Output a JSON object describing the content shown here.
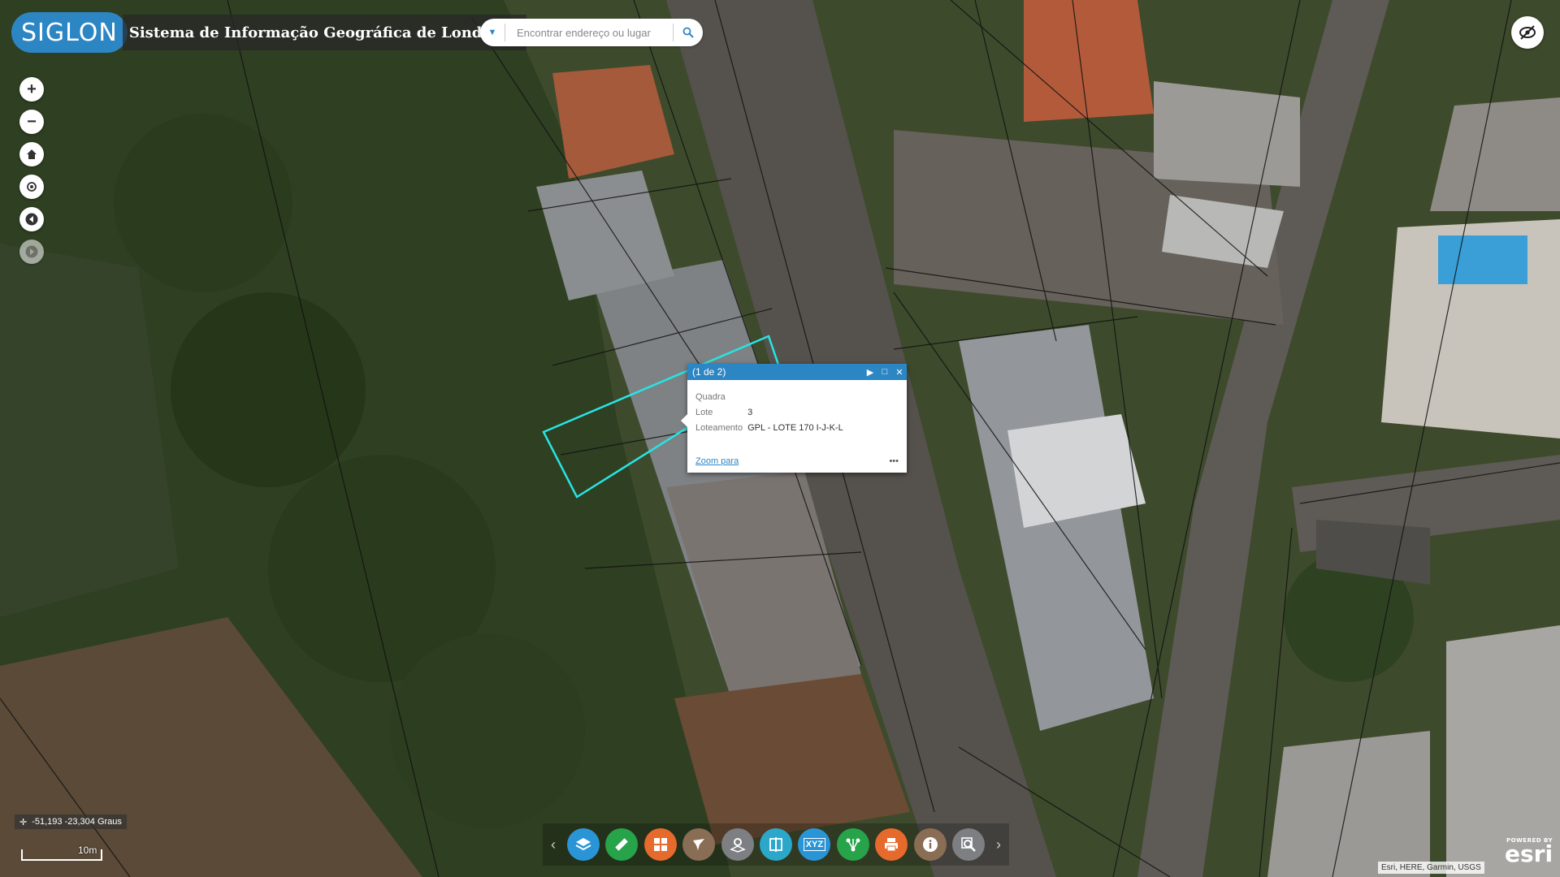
{
  "header": {
    "logo_text": "SIGLON",
    "title": "Sistema de Informação Geográfica de Londrina"
  },
  "search": {
    "placeholder": "Encontrar endereço ou lugar"
  },
  "popup": {
    "counter": "(1 de 2)",
    "fields": [
      {
        "label": "Quadra",
        "value": ""
      },
      {
        "label": "Lote",
        "value": "3"
      },
      {
        "label": "Loteamento",
        "value": "GPL - LOTE 170 I-J-K-L"
      }
    ],
    "zoom_link": "Zoom para",
    "more": "•••"
  },
  "coordinates": "-51,193 -23,304 Graus",
  "scale_label": "10m",
  "attribution": "Esri, HERE, Garmin, USGS",
  "esri_logo": {
    "powered_by": "POWERED BY",
    "brand": "esri"
  },
  "toolbar": {
    "tools": [
      {
        "name": "layers-tool",
        "icon": "layers-icon",
        "color": "#2a95d6"
      },
      {
        "name": "measure-tool",
        "icon": "ruler-icon",
        "color": "#27a34a"
      },
      {
        "name": "basemap-tool",
        "icon": "grid-icon",
        "color": "#e66a2c"
      },
      {
        "name": "draw-tool",
        "icon": "draw-icon",
        "color": "#8a6d55"
      },
      {
        "name": "bookmark-tool",
        "icon": "bookmark-icon",
        "color": "#7e7f83"
      },
      {
        "name": "swipe-tool",
        "icon": "swipe-icon",
        "color": "#2aa7c9"
      },
      {
        "name": "coordinate-tool",
        "icon": "xyz-icon",
        "color": "#2a95d6"
      },
      {
        "name": "share-tool",
        "icon": "share-icon",
        "color": "#27a34a"
      },
      {
        "name": "print-tool",
        "icon": "print-icon",
        "color": "#e66a2c"
      },
      {
        "name": "about-tool",
        "icon": "info-icon",
        "color": "#8a6d55"
      },
      {
        "name": "search-map-tool",
        "icon": "zoom-search-icon",
        "color": "#7e7f83"
      }
    ],
    "xyz_label": "XYZ"
  }
}
